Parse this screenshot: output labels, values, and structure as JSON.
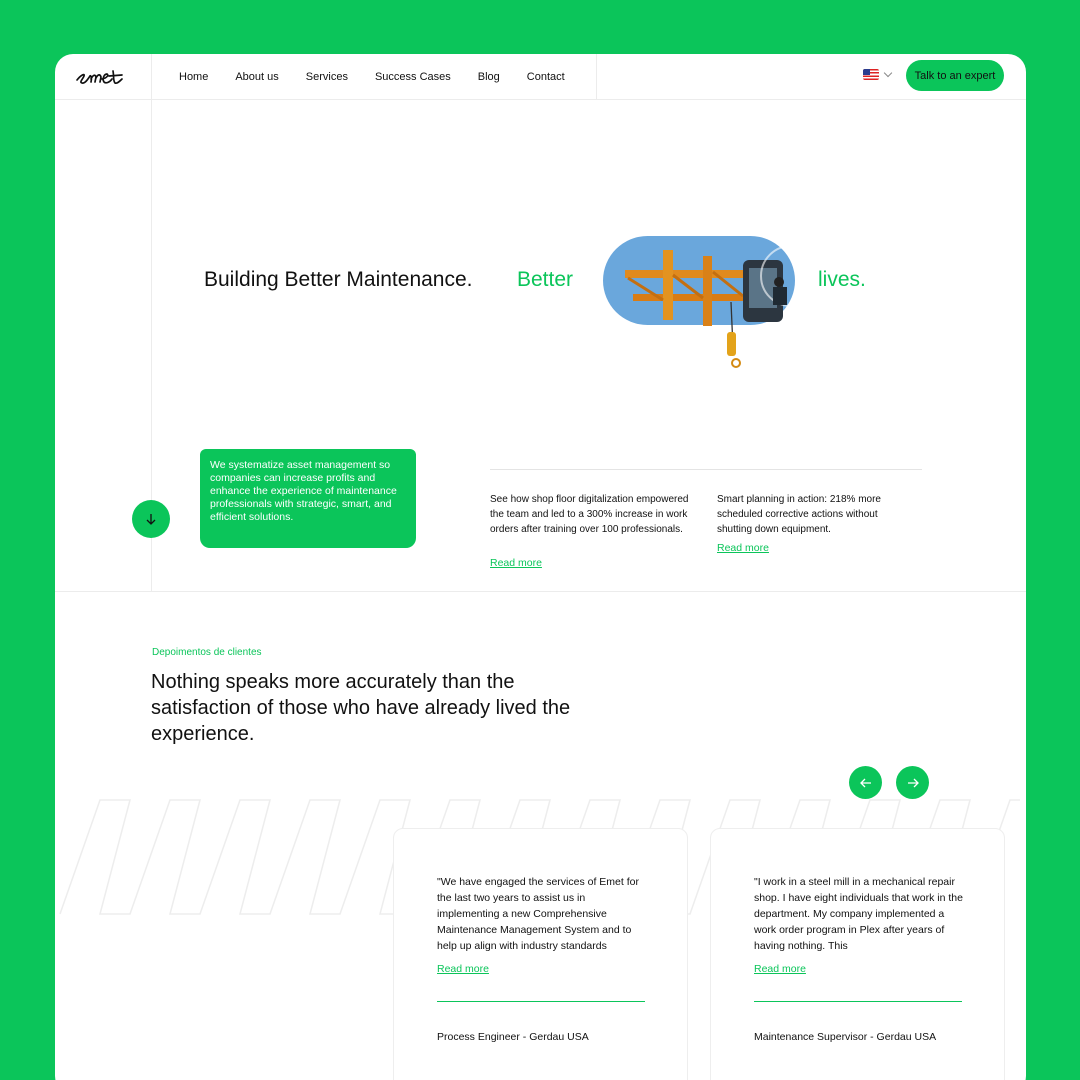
{
  "brand": {
    "logo_text": "emet",
    "accent": "#0bc55a"
  },
  "nav": {
    "items": [
      "Home",
      "About us",
      "Services",
      "Success Cases",
      "Blog",
      "Contact"
    ]
  },
  "header": {
    "language_icon": "us-flag-icon",
    "cta_label": "Talk to an expert"
  },
  "hero": {
    "headline_part1": "Building Better Maintenance.",
    "headline_part2": "Better",
    "headline_part3": "lives."
  },
  "intro": {
    "text": "We systematize asset management so companies can increase profits and enhance the experience of maintenance professionals with strategic, smart, and efficient solutions."
  },
  "cases": [
    {
      "text": "See how shop floor digitalization empowered the team and led to a 300% increase in work orders after training over 100 professionals.",
      "link": "Read more"
    },
    {
      "text": "Smart planning in action: 218% more scheduled corrective actions without shutting down equipment.",
      "link": "Read more"
    }
  ],
  "testimonials": {
    "eyebrow": "Depoimentos de clientes",
    "heading": "Nothing speaks more accurately than the satisfaction of those who have already lived the experience.",
    "items": [
      {
        "quote": "\"We have engaged the services of Emet for the last two years to assist us in implementing a new Comprehensive Maintenance Management System and to help up align with industry standards",
        "link": "Read more",
        "role": "Process Engineer - Gerdau USA"
      },
      {
        "quote": "\"I work in a steel mill in a mechanical repair shop. I have eight individuals that work in the department. My company implemented a work order program in Plex after years of having nothing. This",
        "link": "Read more",
        "role": "Maintenance Supervisor - Gerdau USA"
      }
    ]
  }
}
